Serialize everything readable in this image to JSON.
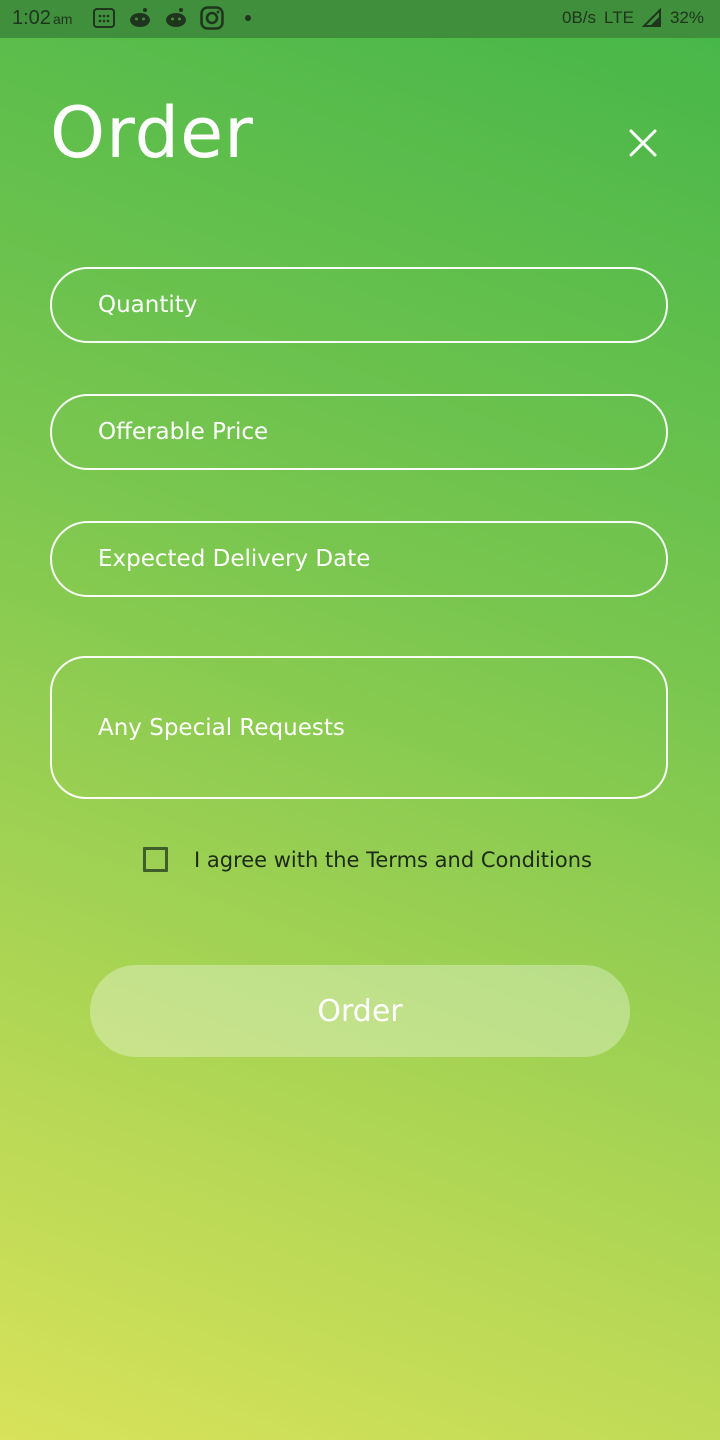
{
  "status_bar": {
    "time": "1:02",
    "ampm": "am",
    "network_speed": "0B/s",
    "network_type": "LTE",
    "battery": "32%",
    "icons": [
      "calendar-icon",
      "reddit-icon",
      "reddit-icon",
      "instagram-icon",
      "dot-icon",
      "signal-icon"
    ]
  },
  "header": {
    "title": "Order",
    "close_icon": "close-icon"
  },
  "form": {
    "quantity_placeholder": "Quantity",
    "price_placeholder": "Offerable Price",
    "date_placeholder": "Expected Delivery Date",
    "requests_placeholder": "Any Special Requests",
    "terms_label": "I agree with the Terms and Conditions",
    "terms_checked": false,
    "submit_label": "Order"
  },
  "colors": {
    "status_bar": "#3f8f3c",
    "gradient_top": "#45b649",
    "gradient_bottom": "#d8e25a",
    "text_light": "#ffffff"
  }
}
